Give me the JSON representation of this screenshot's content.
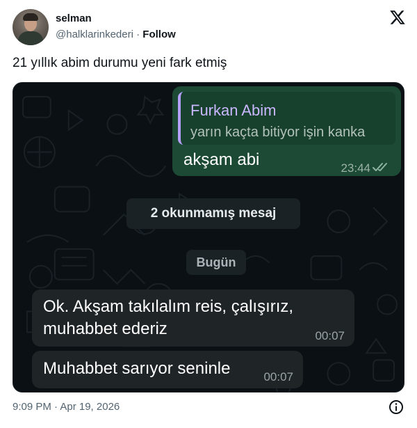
{
  "author": {
    "name": "selman",
    "handle": "@halklarinkederi",
    "separator": "·",
    "follow_label": "Follow"
  },
  "icons": {
    "platform": "x-logo-icon",
    "info": "info-icon",
    "read_receipt": "double-check-icon"
  },
  "tweet": {
    "text": "21 yıllık abim durumu yeni fark etmiş",
    "timestamp": "9:09 PM · Apr 19, 2026"
  },
  "chat": {
    "outgoing": {
      "quoted_name": "Furkan Abim",
      "quoted_text": "yarın kaçta bitiyor işin kanka",
      "text": "akşam abi",
      "time": "23:44"
    },
    "unread_label": "2 okunmamış mesaj",
    "date_label": "Bugün",
    "incoming": [
      {
        "text": "Ok. Akşam takılalım reis, çalışırız, muhabbet ederiz",
        "time": "00:07"
      },
      {
        "text": "Muhabbet sarıyor seninle",
        "time": "00:07"
      }
    ]
  },
  "colors": {
    "chat_background": "#0b1014",
    "outgoing_bubble": "#1d4a35",
    "incoming_bubble": "#1f2427",
    "quote_accent": "#b59fff",
    "read_tick": "#8fb3a3"
  }
}
